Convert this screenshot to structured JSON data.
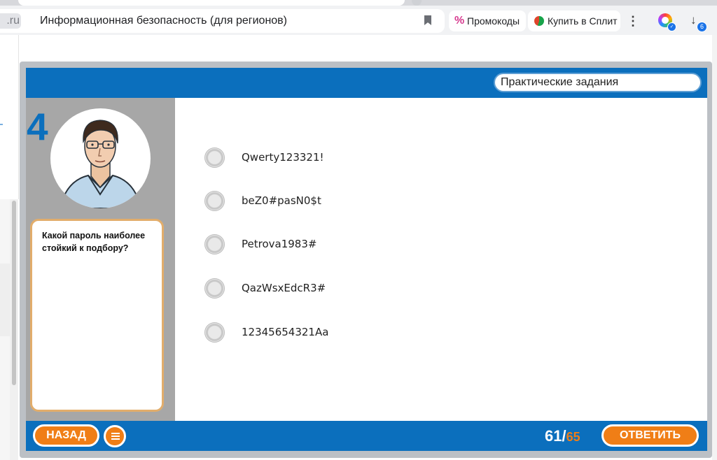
{
  "browser": {
    "domain_fragment": ".ru",
    "page_title": "Информационная безопасность (для регионов)",
    "promo_chip": "Промокоды",
    "split_chip": "Купить в Сплит",
    "downloads_count": "6"
  },
  "course": {
    "section": "Практические задания",
    "question_number": "4",
    "question_text": "Какой пароль наиболее стойкий к подбору?",
    "options": [
      "Qwerty123321!",
      "beZ0#pasN0$t",
      "Petrova1983#",
      "QazWsxEdcR3#",
      "12345654321Aa"
    ],
    "back_label": "НАЗАД",
    "submit_label": "ОТВЕТИТЬ",
    "progress_current": "61/",
    "progress_total": "65",
    "colors": {
      "brand_blue": "#0b6fbd",
      "accent_orange": "#f07e16",
      "card_border": "#e2ad6b"
    }
  }
}
